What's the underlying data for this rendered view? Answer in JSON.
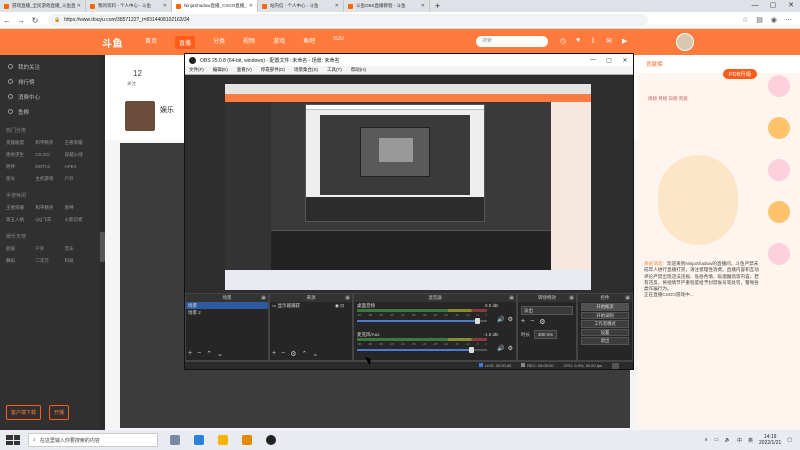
{
  "browser": {
    "tabs": [
      {
        "label": "游戏直播_全民游戏直播_斗鱼直",
        "active": false
      },
      {
        "label": "我的资料 - 个人中心 - 斗鱼",
        "active": false
      },
      {
        "label": "NinjaShadow直播_CSGO直播_斗",
        "active": true
      },
      {
        "label": "站内信 - 个人中心 - 斗鱼",
        "active": false
      },
      {
        "label": "斗鱼OBS直播教程 - 斗鱼",
        "active": false
      }
    ],
    "new_tab": "+",
    "controls": {
      "minimize": "—",
      "maximize": "▢",
      "close": "✕"
    },
    "url": "https://www.douyu.com/3857122?_t=8314408102163/34",
    "nav": {
      "back": "←",
      "forward": "→",
      "reload": "↻"
    }
  },
  "douyu": {
    "logo": "斗鱼",
    "nav": [
      "首页",
      "直播",
      "分类",
      "视频",
      "游戏",
      "鱼吧",
      "S20"
    ],
    "search_placeholder": "搜索",
    "room": {
      "count": "12",
      "sub": "关注",
      "host": "娱乐"
    },
    "sidebar": {
      "items": [
        "我的关注",
        "排行榜",
        "消费中心",
        "鱼粮"
      ],
      "section1": "热门分类",
      "grid1": [
        "英雄联盟",
        "和平精英",
        "王者荣耀",
        "绝地求生",
        "CS:GO",
        "穿越火线",
        "原神",
        "DOTA2",
        "APEX",
        "星光",
        "主机游戏",
        "户外"
      ],
      "section2": "手游休闲",
      "grid2": [
        "王者荣耀",
        "和平精英",
        "原神",
        "第五人格",
        "QQ飞车",
        "火影忍者"
      ],
      "section3": "娱乐天地",
      "grid3": [
        "颜值",
        "户外",
        "音乐",
        "舞蹈",
        "二次元",
        "科技"
      ],
      "buttons": [
        "客户端下载",
        "开播"
      ]
    },
    "right": {
      "head": "贡献榜",
      "badge": "PDB升级",
      "rank": "周榜 月榜 日榜 贵族",
      "msg_name": "系统消息：",
      "msg": "欢迎来到NinjaShadow的直播间，斗鱼严禁未成年人进行直播打赏，请注意理性消费。直播内容和互动评论严禁出现违法违规、低俗色情、吸烟酗酒等内容，若有违反，将视情节严重程度给予封禁账号等处罚，警惕各类诈骗行为。",
      "msg2": "正在直播CSGO游戏中..."
    }
  },
  "obs": {
    "title": "OBS 25.0.8 (64-bit, windows) - 配置文件: 未命名 - 场景: 未命名",
    "menu": [
      "文件(F)",
      "编辑(E)",
      "查看(V)",
      "停靠部件(D)",
      "场景集合(S)",
      "工具(T)",
      "帮助(H)"
    ],
    "docks": {
      "scenes": {
        "title": "场景",
        "items": [
          "场景",
          "场景 2"
        ],
        "selected": 0
      },
      "sources": {
        "title": "来源",
        "items": [
          "显示器捕获"
        ]
      },
      "mixer": {
        "title": "混音器",
        "channels": [
          {
            "name": "桌面音频",
            "db": "0.0 dB",
            "level": 0.92
          },
          {
            "name": "麦克风/Aux",
            "db": "-1.9 dB",
            "level": 0.88
          }
        ],
        "ticks": [
          "-60",
          "-55",
          "-50",
          "-45",
          "-40",
          "-35",
          "-30",
          "-25",
          "-20",
          "-15",
          "-10",
          "-5",
          "0"
        ]
      },
      "transitions": {
        "title": "转场特效",
        "type": "淡出",
        "duration_label": "时长",
        "duration": "300 ms"
      },
      "controls": {
        "title": "控件",
        "buttons": [
          "开始推流",
          "开始录制",
          "工作室模式",
          "设置",
          "退出"
        ]
      }
    },
    "status": {
      "live": "LIVE: 00:00:00",
      "rec": "REC: 00:00:00",
      "cpu": "CPU: 0.9%, 30.00 fps"
    }
  },
  "taskbar": {
    "search_placeholder": "在这里输入你要搜索的内容",
    "time": "14:19",
    "date": "2022/1/21",
    "tray": [
      "∧",
      "中",
      "英"
    ]
  },
  "colors": {
    "douyu_orange": "#ff7a3d",
    "obs_bg": "#2e2e2e",
    "selected": "#2d5aa0"
  }
}
